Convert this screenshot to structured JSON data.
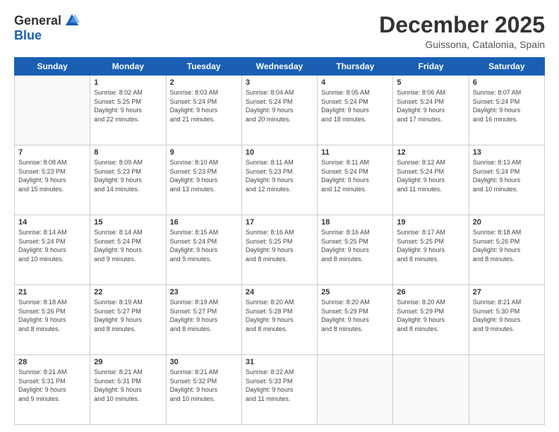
{
  "logo": {
    "general": "General",
    "blue": "Blue"
  },
  "title": "December 2025",
  "subtitle": "Guissona, Catalonia, Spain",
  "days_of_week": [
    "Sunday",
    "Monday",
    "Tuesday",
    "Wednesday",
    "Thursday",
    "Friday",
    "Saturday"
  ],
  "weeks": [
    [
      {
        "day": "",
        "info": ""
      },
      {
        "day": "1",
        "info": "Sunrise: 8:02 AM\nSunset: 5:25 PM\nDaylight: 9 hours\nand 22 minutes."
      },
      {
        "day": "2",
        "info": "Sunrise: 8:03 AM\nSunset: 5:24 PM\nDaylight: 9 hours\nand 21 minutes."
      },
      {
        "day": "3",
        "info": "Sunrise: 8:04 AM\nSunset: 5:24 PM\nDaylight: 9 hours\nand 20 minutes."
      },
      {
        "day": "4",
        "info": "Sunrise: 8:05 AM\nSunset: 5:24 PM\nDaylight: 9 hours\nand 18 minutes."
      },
      {
        "day": "5",
        "info": "Sunrise: 8:06 AM\nSunset: 5:24 PM\nDaylight: 9 hours\nand 17 minutes."
      },
      {
        "day": "6",
        "info": "Sunrise: 8:07 AM\nSunset: 5:24 PM\nDaylight: 9 hours\nand 16 minutes."
      }
    ],
    [
      {
        "day": "7",
        "info": "Sunrise: 8:08 AM\nSunset: 5:23 PM\nDaylight: 9 hours\nand 15 minutes."
      },
      {
        "day": "8",
        "info": "Sunrise: 8:09 AM\nSunset: 5:23 PM\nDaylight: 9 hours\nand 14 minutes."
      },
      {
        "day": "9",
        "info": "Sunrise: 8:10 AM\nSunset: 5:23 PM\nDaylight: 9 hours\nand 13 minutes."
      },
      {
        "day": "10",
        "info": "Sunrise: 8:11 AM\nSunset: 5:23 PM\nDaylight: 9 hours\nand 12 minutes."
      },
      {
        "day": "11",
        "info": "Sunrise: 8:11 AM\nSunset: 5:24 PM\nDaylight: 9 hours\nand 12 minutes."
      },
      {
        "day": "12",
        "info": "Sunrise: 8:12 AM\nSunset: 5:24 PM\nDaylight: 9 hours\nand 11 minutes."
      },
      {
        "day": "13",
        "info": "Sunrise: 8:13 AM\nSunset: 5:24 PM\nDaylight: 9 hours\nand 10 minutes."
      }
    ],
    [
      {
        "day": "14",
        "info": "Sunrise: 8:14 AM\nSunset: 5:24 PM\nDaylight: 9 hours\nand 10 minutes."
      },
      {
        "day": "15",
        "info": "Sunrise: 8:14 AM\nSunset: 5:24 PM\nDaylight: 9 hours\nand 9 minutes."
      },
      {
        "day": "16",
        "info": "Sunrise: 8:15 AM\nSunset: 5:24 PM\nDaylight: 9 hours\nand 9 minutes."
      },
      {
        "day": "17",
        "info": "Sunrise: 8:16 AM\nSunset: 5:25 PM\nDaylight: 9 hours\nand 8 minutes."
      },
      {
        "day": "18",
        "info": "Sunrise: 8:16 AM\nSunset: 5:25 PM\nDaylight: 9 hours\nand 8 minutes."
      },
      {
        "day": "19",
        "info": "Sunrise: 8:17 AM\nSunset: 5:25 PM\nDaylight: 9 hours\nand 8 minutes."
      },
      {
        "day": "20",
        "info": "Sunrise: 8:18 AM\nSunset: 5:26 PM\nDaylight: 9 hours\nand 8 minutes."
      }
    ],
    [
      {
        "day": "21",
        "info": "Sunrise: 8:18 AM\nSunset: 5:26 PM\nDaylight: 9 hours\nand 8 minutes."
      },
      {
        "day": "22",
        "info": "Sunrise: 8:19 AM\nSunset: 5:27 PM\nDaylight: 9 hours\nand 8 minutes."
      },
      {
        "day": "23",
        "info": "Sunrise: 8:19 AM\nSunset: 5:27 PM\nDaylight: 9 hours\nand 8 minutes."
      },
      {
        "day": "24",
        "info": "Sunrise: 8:20 AM\nSunset: 5:28 PM\nDaylight: 9 hours\nand 8 minutes."
      },
      {
        "day": "25",
        "info": "Sunrise: 8:20 AM\nSunset: 5:29 PM\nDaylight: 9 hours\nand 8 minutes."
      },
      {
        "day": "26",
        "info": "Sunrise: 8:20 AM\nSunset: 5:29 PM\nDaylight: 9 hours\nand 8 minutes."
      },
      {
        "day": "27",
        "info": "Sunrise: 8:21 AM\nSunset: 5:30 PM\nDaylight: 9 hours\nand 9 minutes."
      }
    ],
    [
      {
        "day": "28",
        "info": "Sunrise: 8:21 AM\nSunset: 5:31 PM\nDaylight: 9 hours\nand 9 minutes."
      },
      {
        "day": "29",
        "info": "Sunrise: 8:21 AM\nSunset: 5:31 PM\nDaylight: 9 hours\nand 10 minutes."
      },
      {
        "day": "30",
        "info": "Sunrise: 8:21 AM\nSunset: 5:32 PM\nDaylight: 9 hours\nand 10 minutes."
      },
      {
        "day": "31",
        "info": "Sunrise: 8:22 AM\nSunset: 5:33 PM\nDaylight: 9 hours\nand 11 minutes."
      },
      {
        "day": "",
        "info": ""
      },
      {
        "day": "",
        "info": ""
      },
      {
        "day": "",
        "info": ""
      }
    ]
  ]
}
